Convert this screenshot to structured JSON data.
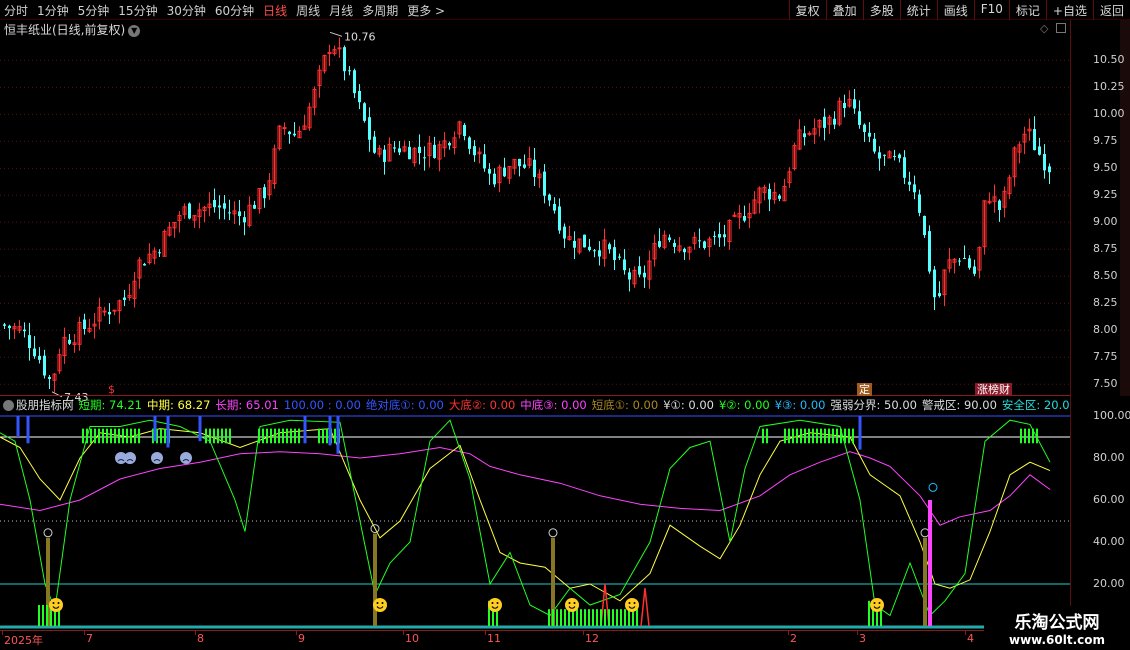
{
  "toolbar": {
    "periods": [
      "分时",
      "1分钟",
      "5分钟",
      "15分钟",
      "30分钟",
      "60分钟",
      "日线",
      "周线",
      "月线",
      "多周期",
      "更多 >"
    ],
    "active_period": "日线",
    "actions": [
      "复权",
      "叠加",
      "多股",
      "统计",
      "画线",
      "F10",
      "标记",
      "+自选",
      "返回"
    ]
  },
  "stock": {
    "title": "恒丰纸业(日线,前复权)"
  },
  "price_axis": {
    "ticks": [
      "10.50",
      "10.25",
      "10.00",
      "9.75",
      "9.50",
      "9.25",
      "9.00",
      "8.75",
      "8.50",
      "8.25",
      "8.00",
      "7.75",
      "7.50"
    ]
  },
  "indicator_axis": {
    "ticks": [
      "100.00",
      "80.00",
      "60.00",
      "40.00",
      "20.00"
    ]
  },
  "annotations": {
    "high": "10.76",
    "low": "7.43"
  },
  "tags": {
    "cai": "$",
    "ding": "定",
    "zhangbang": "涨榜财"
  },
  "indicator": {
    "name": "股朋指标网",
    "items": [
      {
        "label": "短期: 74.21",
        "color": "#22ff22"
      },
      {
        "label": "中期: 68.27",
        "color": "#ffff44"
      },
      {
        "label": "长期: 65.01",
        "color": "#ff44ff"
      },
      {
        "label": "100.00 : 0.00",
        "color": "#3355ff"
      },
      {
        "label": "绝对底①: 0.00",
        "color": "#3355ff"
      },
      {
        "label": "大底②: 0.00",
        "color": "#ff3333"
      },
      {
        "label": "中底③: 0.00",
        "color": "#ff44ff"
      },
      {
        "label": "短底①: 0.00",
        "color": "#aa8822"
      },
      {
        "label": "¥①: 0.00",
        "color": "#dddddd"
      },
      {
        "label": "¥②: 0.00",
        "color": "#22ff22"
      },
      {
        "label": "¥③: 0.00",
        "color": "#22bbff"
      },
      {
        "label": "强弱分界: 50.00",
        "color": "#dddddd"
      },
      {
        "label": "警戒区: 90.00",
        "color": "#dddddd"
      },
      {
        "label": "安全区: 20.00",
        "color": "#22dddd"
      }
    ]
  },
  "xaxis": {
    "labels": [
      "2025年",
      "7",
      "8",
      "9",
      "10",
      "11",
      "12",
      "2",
      "3",
      "4"
    ]
  },
  "watermark": {
    "line1": "乐淘公式网",
    "line2": "www.60lt.com"
  },
  "colors": {
    "up": "#ff3030",
    "down": "#54ffff",
    "background": "#000000",
    "grid_red": "#8a1a1a"
  },
  "chart_data": {
    "type": "candlestick",
    "price_range": [
      7.4,
      10.8
    ],
    "high": 10.76,
    "low": 7.43,
    "indicator_range": [
      0,
      100
    ],
    "indicator_lines": {
      "strong_weak": 50,
      "warning": 90,
      "safe": 20
    },
    "indicator_latest": {
      "short": 74.21,
      "mid": 68.27,
      "long": 65.01
    }
  }
}
